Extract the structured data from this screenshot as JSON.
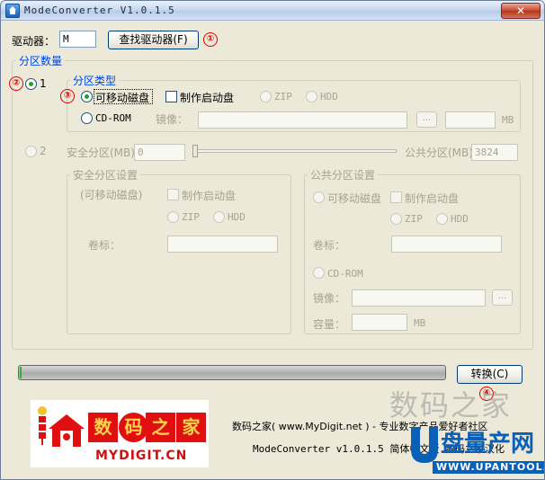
{
  "window": {
    "title": "ModeConverter V1.0.1.5",
    "close_glyph": "✕"
  },
  "drive": {
    "label": "驱动器：",
    "value": "M",
    "find_button": "查找驱动器(F)"
  },
  "partition_count": {
    "group_title": "分区数量",
    "option1": "1",
    "option2": "2",
    "secure_label": "安全分区(MB)",
    "secure_value": "0",
    "public_label": "公共分区(MB)",
    "public_value": "3824"
  },
  "partition_type": {
    "group_title": "分区类型",
    "removable": "可移动磁盘",
    "make_boot": "制作启动盘",
    "zip": "ZIP",
    "hdd": "HDD",
    "cdrom": "CD-ROM",
    "image_label": "镜像：",
    "browse": "...",
    "mb": "MB"
  },
  "secure_settings": {
    "group_title": "安全分区设置",
    "type_text": "(可移动磁盘)",
    "make_boot": "制作启动盘",
    "zip": "ZIP",
    "hdd": "HDD",
    "volume_label": "卷标："
  },
  "public_settings": {
    "group_title": "公共分区设置",
    "removable": "可移动磁盘",
    "make_boot": "制作启动盘",
    "zip": "ZIP",
    "hdd": "HDD",
    "volume_label": "卷标：",
    "cdrom": "CD-ROM",
    "image_label": "镜像：",
    "browse": "...",
    "capacity_label": "容量：",
    "mb": "MB"
  },
  "convert_button": "转换(C)",
  "progress": {
    "fraction": 0.004
  },
  "markers": [
    "①",
    "②",
    "③",
    "④"
  ],
  "footer": {
    "line1": "数码之家( www.MyDigit.net ) - 专业数字产品爱好者社区",
    "line2": "ModeConverter v1.0.1.5 简体中文版  数码之家汉化"
  },
  "logo": {
    "chars": [
      "数",
      "码",
      "之",
      "家"
    ],
    "english": "MYDIGIT.CN"
  },
  "watermark": {
    "text": "数码之家",
    "brand": "盘量产网",
    "url": "WWW.UPANTOOL.COM"
  },
  "colors": {
    "accent_blue": "#0046d5",
    "marker_red": "#e00000",
    "progress_green": "#28b82a",
    "logo_red": "#e01010"
  }
}
